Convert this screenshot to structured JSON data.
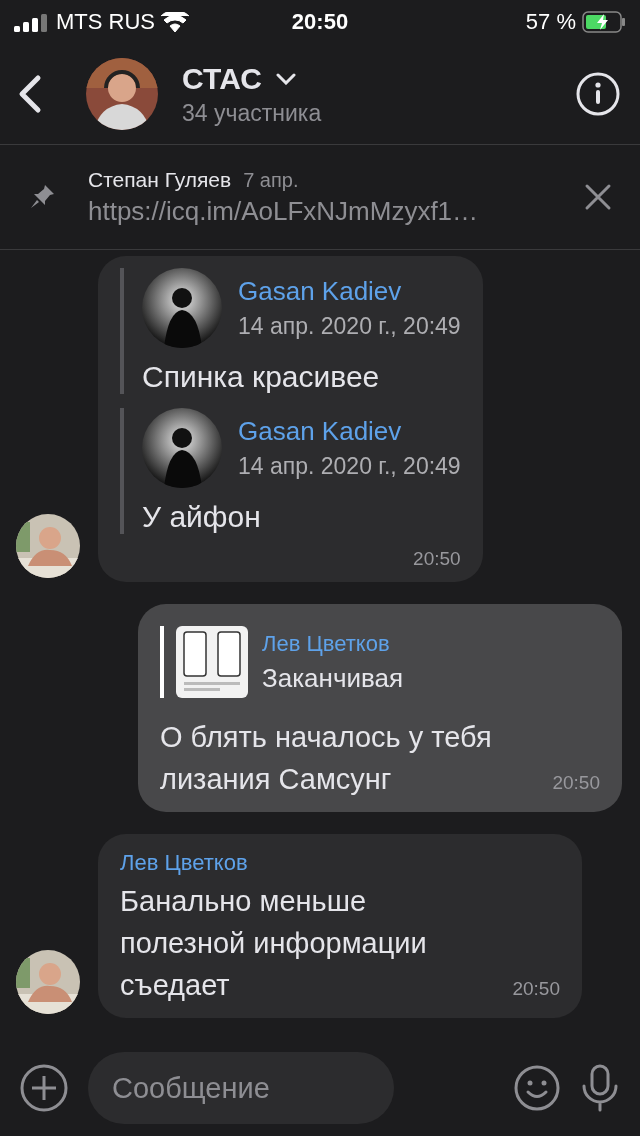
{
  "status_bar": {
    "carrier": "MTS RUS",
    "time": "20:50",
    "battery": "57 %"
  },
  "header": {
    "title": "СТАС",
    "subtitle": "34 участника"
  },
  "pinned": {
    "author": "Степан Гуляев",
    "date": "7 апр.",
    "text": "https://icq.im/AoLFxNJmMzyxf1…"
  },
  "messages": [
    {
      "kind": "incoming",
      "avatar": true,
      "quotes": [
        {
          "author": "Gasan Kadiev",
          "date": "14 апр. 2020 г., 20:49",
          "text": "Спинка красивее"
        },
        {
          "author": "Gasan Kadiev",
          "date": "14 апр. 2020 г., 20:49",
          "text": "У айфон"
        }
      ],
      "time": "20:50"
    },
    {
      "kind": "outgoing",
      "reply": {
        "author": "Лев Цветков",
        "text": "Заканчивая"
      },
      "text": "О блять началось у тебя лизания Самсунг",
      "time": "20:50"
    },
    {
      "kind": "incoming",
      "avatar": true,
      "author": "Лев Цветков",
      "text": "Банально меньше полезной информации съедает",
      "time": "20:50"
    }
  ],
  "composer": {
    "placeholder": "Сообщение"
  }
}
